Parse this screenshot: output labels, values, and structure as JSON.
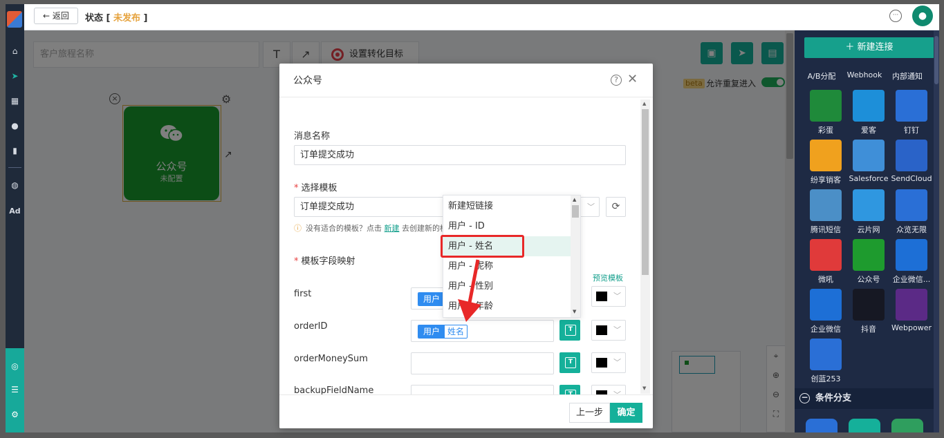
{
  "header": {
    "back_label": "返回",
    "status_label": "状态 [",
    "status_value": "未发布",
    "status_close": "]"
  },
  "canvas": {
    "journey_name_placeholder": "客户旅程名称",
    "text_tool": "T",
    "arrow_tool": "↗",
    "goal_label": "设置转化目标",
    "beta_badge": "beta",
    "reenter_label": "允许重复进入",
    "reenter_enabled": true,
    "node": {
      "title": "公众号",
      "subtitle": "未配置"
    }
  },
  "palette": {
    "new_connection": "＋ 新建连接",
    "top_labels": [
      "A/B分配",
      "Webhook",
      "内部通知"
    ],
    "items": [
      {
        "label": "彩蛋",
        "icon": "spider-icon",
        "color": "#1f8a3a"
      },
      {
        "label": "爱客",
        "icon": "k-icon",
        "color": "#1d8fd9"
      },
      {
        "label": "钉钉",
        "icon": "dingtalk-icon",
        "color": "#2a6fd6"
      },
      {
        "label": "纷享销客",
        "icon": "robot-icon",
        "color": "#f0a11e"
      },
      {
        "label": "Salesforce",
        "icon": "cloud-icon",
        "color": "#3f8fd8"
      },
      {
        "label": "SendCloud",
        "icon": "sendcloud-icon",
        "color": "#2a63c8"
      },
      {
        "label": "腾讯短信",
        "icon": "tencent-cloud-icon",
        "color": "#4b8fc7"
      },
      {
        "label": "云片网",
        "icon": "yunpian-icon",
        "color": "#2f97e0"
      },
      {
        "label": "众览无限",
        "icon": "zhonglan-icon",
        "color": "#2a6fd6"
      },
      {
        "label": "微吼",
        "icon": "vhall-icon",
        "color": "#e03a3a"
      },
      {
        "label": "公众号",
        "icon": "wechat-icon",
        "color": "#1e9b2e"
      },
      {
        "label": "企业微信...",
        "icon": "wecom-icon",
        "color": "#1d6fd6"
      },
      {
        "label": "企业微信",
        "icon": "wecom-chat-icon",
        "color": "#1d6fd6"
      },
      {
        "label": "抖音",
        "icon": "tiktok-icon",
        "color": "#161823"
      },
      {
        "label": "Webpower",
        "icon": "webpower-icon",
        "color": "#5b2a86"
      },
      {
        "label": "创蓝253",
        "icon": "chuanglan-icon",
        "color": "#2a6fd6"
      }
    ],
    "branch_header": "条件分支"
  },
  "modal": {
    "title": "公众号",
    "message_name_label": "消息名称",
    "message_name_value": "订单提交成功",
    "template_label": "选择模板",
    "template_value": "订单提交成功",
    "hint_prefix": "没有适合的模板？点击",
    "hint_link": "新建",
    "hint_suffix": "去创建新的模板",
    "mapping_label": "模板字段映射",
    "preview_link": "预览模板",
    "fields": [
      {
        "name": "first",
        "tag_a": "用户",
        "tag_b": "",
        "has_tag": true
      },
      {
        "name": "orderID",
        "tag_a": "用户",
        "tag_b": "姓名",
        "has_tag": true
      },
      {
        "name": "orderMoneySum",
        "tag_a": "",
        "tag_b": "",
        "has_tag": false
      },
      {
        "name": "backupFieldName",
        "tag_a": "",
        "tag_b": "",
        "has_tag": false
      }
    ],
    "prev_button": "上一步",
    "ok_button": "确定"
  },
  "dropdown": {
    "items": [
      "新建短链接",
      "用户 - ID",
      "用户 - 姓名",
      "用户 - 昵称",
      "用户 - 性别",
      "用户 - 年龄"
    ],
    "highlighted": "用户 - 姓名"
  },
  "colors": {
    "accent": "#15b09a",
    "tag_blue": "#2f8cf0",
    "annotation_red": "#e82828",
    "wechat_green": "#199b2c"
  }
}
